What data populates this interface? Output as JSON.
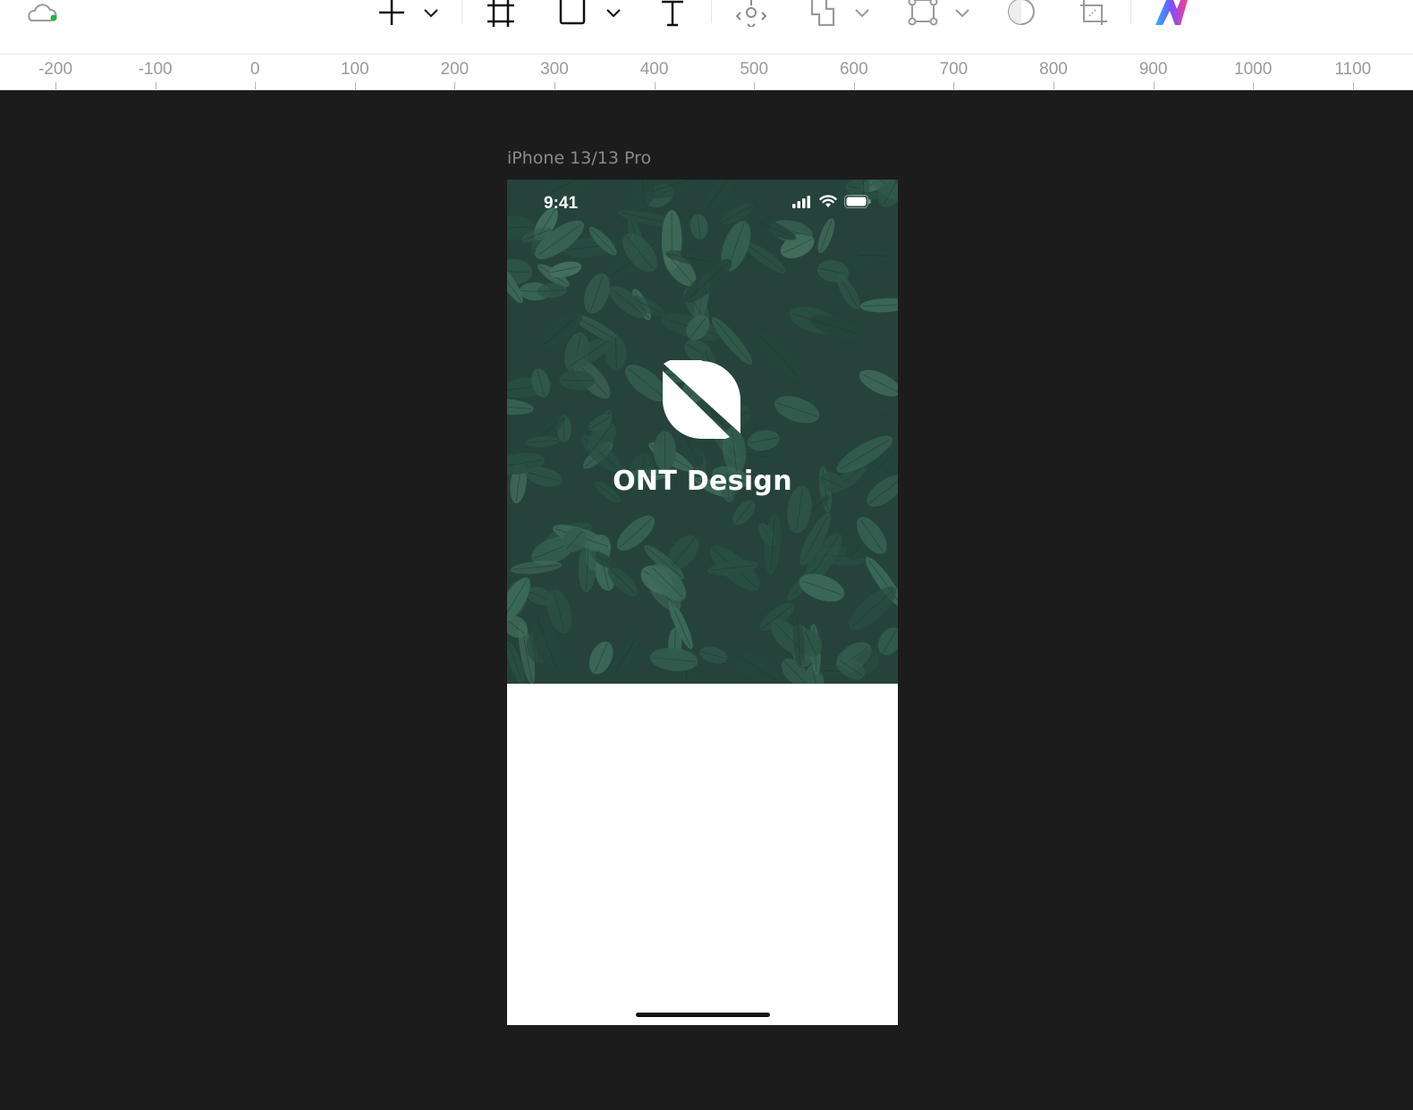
{
  "toolbar": {
    "tools": [
      {
        "name": "cloud-sync-icon",
        "status_color": "#22b14c"
      },
      {
        "name": "add-icon"
      },
      {
        "name": "frame-icon"
      },
      {
        "name": "rectangle-icon"
      },
      {
        "name": "text-icon"
      },
      {
        "name": "component-icon"
      },
      {
        "name": "boolean-icon"
      },
      {
        "name": "vector-icon"
      },
      {
        "name": "mask-icon"
      },
      {
        "name": "crop-icon"
      },
      {
        "name": "plugin-logo-icon"
      }
    ]
  },
  "ruler": {
    "labels": [
      "-200",
      "-100",
      "0",
      "100",
      "200",
      "300",
      "400",
      "500",
      "600",
      "700",
      "800",
      "900",
      "1000",
      "1100"
    ]
  },
  "canvas": {
    "frame_label": "iPhone 13/13 Pro",
    "phone": {
      "status_time": "9:41",
      "app_name": "ONT Design",
      "hero_color": "#2b4a40"
    }
  }
}
